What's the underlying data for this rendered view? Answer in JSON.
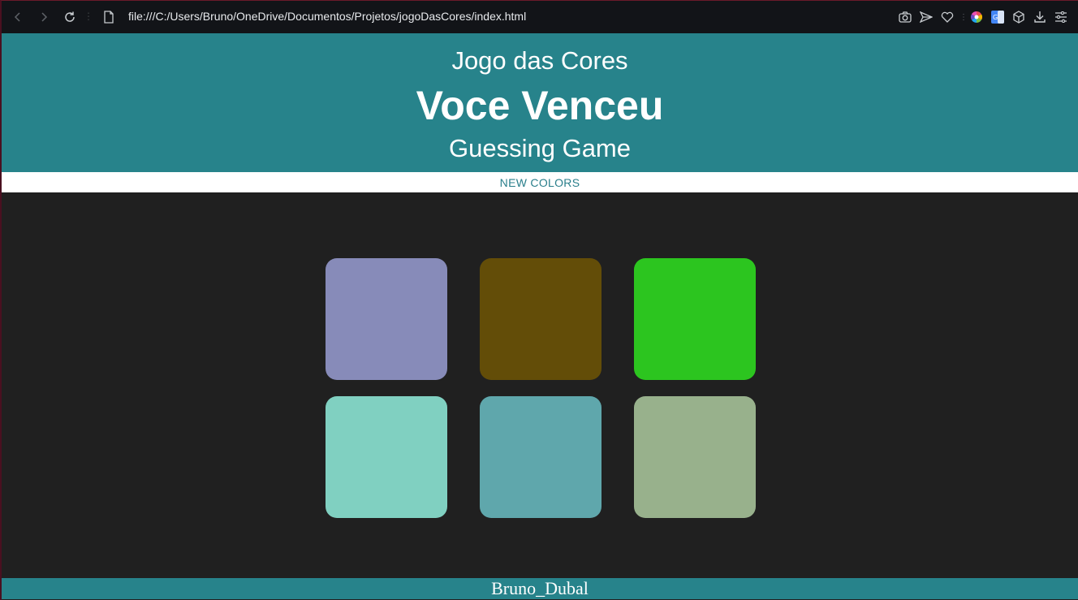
{
  "browser": {
    "url": "file:///C:/Users/Bruno/OneDrive/Documentos/Projetos/jogoDasCores/index.html",
    "icons": {
      "back": "back-icon",
      "forward": "forward-icon",
      "reload": "reload-icon",
      "page": "page-icon",
      "camera": "camera-icon",
      "send": "send-icon",
      "heart": "heart-icon",
      "color_wheel": "color-wheel-icon",
      "translate": "translate-icon",
      "cube": "cube-icon",
      "download": "download-icon",
      "settings": "settings-icon"
    }
  },
  "header": {
    "subtitle_top": "Jogo das Cores",
    "message": "Voce Venceu",
    "subtitle_bottom": "Guessing Game",
    "background": "#27838b"
  },
  "controls": {
    "new_colors_label": "NEW COLORS"
  },
  "squares": [
    {
      "color": "#878bb9"
    },
    {
      "color": "#634d08"
    },
    {
      "color": "#2cc51f"
    },
    {
      "color": "#80d0c1"
    },
    {
      "color": "#5fa7ac"
    },
    {
      "color": "#98b18c"
    }
  ],
  "footer": {
    "author": "Bruno_Dubal"
  }
}
